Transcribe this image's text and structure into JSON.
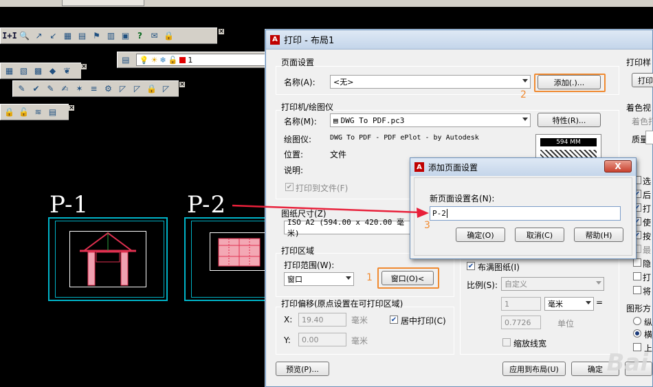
{
  "cad": {
    "layer_value": "1",
    "drawing_labels": [
      "P-1",
      "P-2"
    ],
    "toolbar_text_button": "I+I"
  },
  "dialog": {
    "title": "打印 - 布局1",
    "page_setup": {
      "group": "页面设置",
      "name_label": "名称(A):",
      "name_value": "<无>",
      "add_button": "添加(.)..."
    },
    "printer": {
      "group": "打印机/绘图仪",
      "name_label": "名称(M):",
      "name_value": "DWG To PDF.pc3",
      "properties_button": "特性(R)...",
      "plotter_label": "绘图仪:",
      "plotter_value": "DWG To PDF - PDF ePlot - by Autodesk",
      "location_label": "位置:",
      "location_value": "文件",
      "description_label": "说明:",
      "print_to_file": "打印到文件(F)",
      "preview_dim": "594 MM"
    },
    "paper": {
      "group": "图纸尺寸(Z)",
      "value": "ISO A2 (594.00 x 420.00 毫米)"
    },
    "plot_area": {
      "group": "打印区域",
      "range_label": "打印范围(W):",
      "range_value": "窗口",
      "window_button": "窗口(O)<"
    },
    "offset": {
      "group": "打印偏移(原点设置在可打印区域)",
      "x_label": "X:",
      "x_value": "19.40",
      "y_label": "Y:",
      "y_value": "0.00",
      "unit": "毫米",
      "center_label": "居中打印(C)"
    },
    "scale": {
      "fit_label": "布满图纸(I)",
      "scale_label": "比例(S):",
      "scale_value": "自定义",
      "v1": "1",
      "unit": "毫米",
      "v2": "0.7726",
      "unit2": "单位",
      "lineweights": "缩放线宽"
    },
    "right_panel": {
      "style_table": "打印样",
      "style_btn": "打印",
      "shaded": "着色视",
      "shade_label": "着色打",
      "quality": "质量",
      "options": [
        "选",
        "后",
        "打",
        "使",
        "按",
        "最",
        "隐",
        "打",
        "将"
      ],
      "orientation": "图形方",
      "orient_options": [
        "纵",
        "横",
        "上"
      ]
    },
    "buttons": {
      "preview": "预览(P)...",
      "apply": "应用到布局(U)",
      "ok": "确定"
    },
    "steps": [
      "1",
      "2",
      "3"
    ]
  },
  "subdialog": {
    "title": "添加页面设置",
    "close": "X",
    "field_label": "新页面设置名(N):",
    "field_value": "P-2",
    "ok": "确定(O)",
    "cancel": "取消(C)",
    "help": "帮助(H)"
  },
  "watermark": "Bai"
}
